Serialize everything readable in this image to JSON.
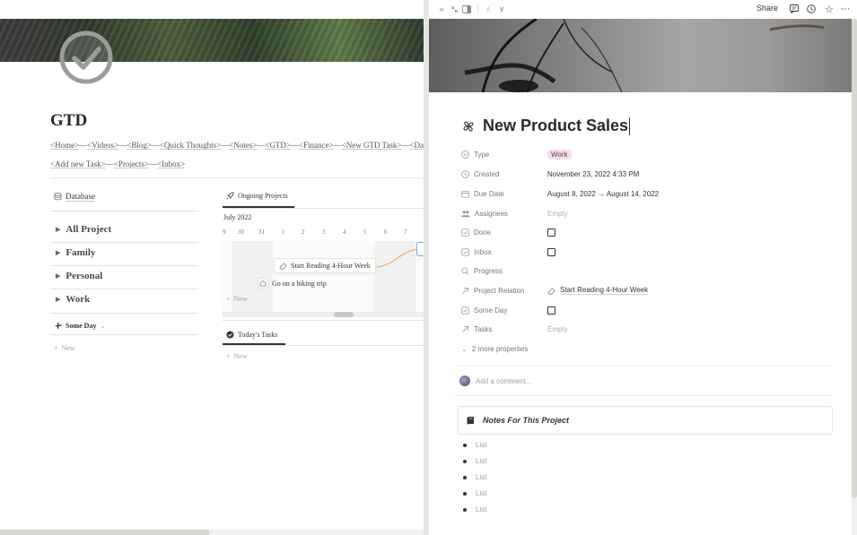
{
  "left": {
    "title": "GTD",
    "links_row1": [
      "<Home>",
      "<Videos>",
      "<Blog>",
      "<Quick Thoughts>",
      "<Notes>",
      "<GTD>",
      "<Finance>",
      "<New GTD Task>",
      "<Databa"
    ],
    "links_row2": [
      "<Add new Task>",
      "<Projects>",
      "<Inbox>"
    ],
    "link_separator": "—",
    "database_label": "Database",
    "toggles": [
      "All Project",
      "Family",
      "Personal",
      "Work"
    ],
    "someday_label": "Some Day",
    "new_label": "New",
    "timeline": {
      "tab_label": "Ongoing Projects",
      "month": "July 2022",
      "days": [
        "9",
        "30",
        "31",
        "1",
        "2",
        "3",
        "4",
        "5",
        "6",
        "7"
      ],
      "cards": [
        "Start Reading 4-Hour Week",
        "Go on a hiking trip"
      ],
      "new_label": "New"
    },
    "tasks": {
      "tab_label": "Today's Tasks",
      "new_label": "New"
    }
  },
  "right": {
    "topbar": {
      "share_label": "Share",
      "icons": [
        "double-chevron-right-icon",
        "collapse-arrows-icon",
        "side-panel-icon",
        "chevron-up-icon",
        "chevron-down-icon",
        "comment-icon",
        "clock-icon",
        "star-icon",
        "more-icon"
      ]
    },
    "title": "New Product Sales",
    "properties": [
      {
        "name": "Type",
        "icon": "circle-chevron-icon",
        "value": "Work",
        "kind": "tag"
      },
      {
        "name": "Created",
        "icon": "clock-icon",
        "value": "November 23, 2022 4:33 PM",
        "kind": "text"
      },
      {
        "name": "Due Date",
        "icon": "calendar-icon",
        "value": "August 8, 2022 → August 14, 2022",
        "kind": "text"
      },
      {
        "name": "Assignees",
        "icon": "people-icon",
        "value": "Empty",
        "kind": "empty"
      },
      {
        "name": "Done",
        "icon": "checkbox-icon",
        "value": "",
        "kind": "checkbox"
      },
      {
        "name": "Inbox",
        "icon": "checkbox-icon",
        "value": "",
        "kind": "checkbox"
      },
      {
        "name": "Progress",
        "icon": "search-icon",
        "value": "",
        "kind": "text"
      },
      {
        "name": "Project Relation",
        "icon": "relation-arrow-icon",
        "value": "Start Reading 4-Hour Week",
        "kind": "relation"
      },
      {
        "name": "Some Day",
        "icon": "checkbox-icon",
        "value": "",
        "kind": "checkbox"
      },
      {
        "name": "Tasks",
        "icon": "relation-arrow-icon",
        "value": "Empty",
        "kind": "empty"
      }
    ],
    "more_properties": "2 more properties",
    "comment_placeholder": "Add a comment...",
    "callout_title": "Notes For This Project",
    "list_items": [
      "List",
      "List",
      "List",
      "List",
      "List"
    ]
  },
  "colors": {
    "tag_bg": "#f4dfeb",
    "text": "#37352f",
    "muted": "#787774"
  }
}
